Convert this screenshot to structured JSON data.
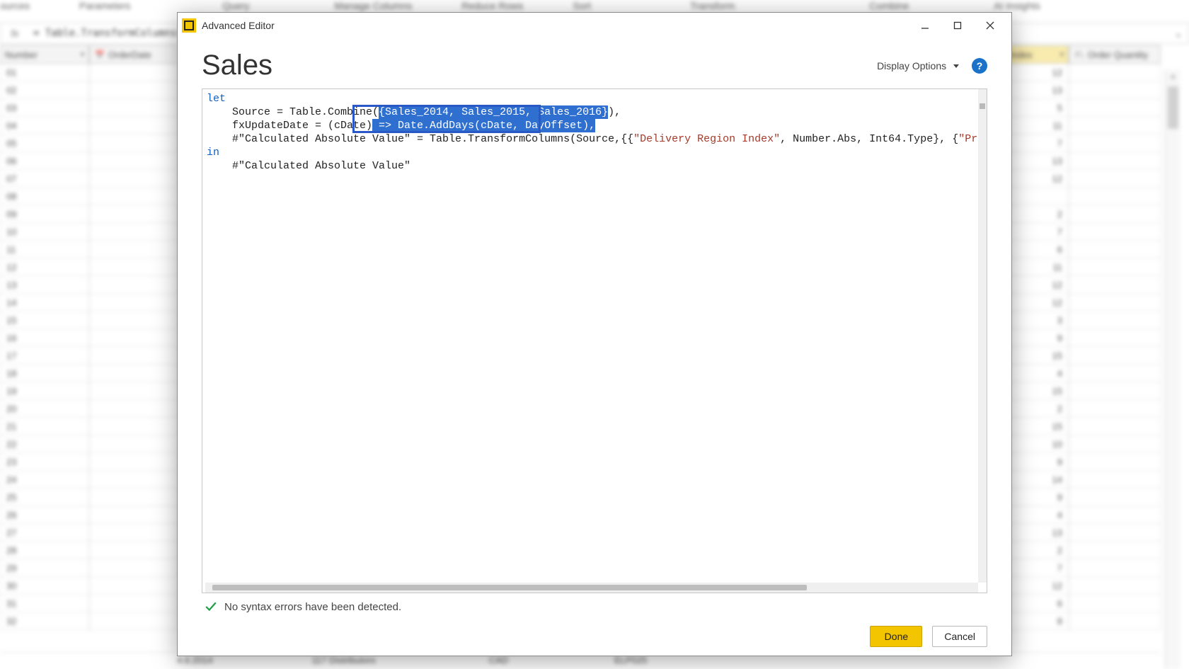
{
  "ribbon": {
    "items": [
      "ources",
      "Parameters",
      "Query",
      "Manage Columns",
      "Reduce Rows",
      "Sort",
      "Transform",
      "Combine",
      "AI Insights"
    ]
  },
  "formula_bar": {
    "fx_label": "fx",
    "text": "= Table.TransformColumns(S",
    "chevron_label": "⌄"
  },
  "grid": {
    "left_headers": {
      "col_a": "Number",
      "col_b": "OrderDate"
    },
    "right_headers": {
      "col_a": "Index",
      "col_b": "Order Quantity"
    },
    "row_labels": [
      "01",
      "02",
      "03",
      "04",
      "05",
      "06",
      "07",
      "08",
      "09",
      "10",
      "11",
      "12",
      "13",
      "14",
      "15",
      "16",
      "17",
      "18",
      "19",
      "20",
      "21",
      "22",
      "23",
      "24",
      "25",
      "26",
      "27",
      "28",
      "29",
      "30",
      "31",
      "32"
    ],
    "right_col_a_values": [
      "12",
      "13",
      "5",
      "11",
      "7",
      "13",
      "12",
      "",
      "2",
      "7",
      "6",
      "11",
      "12",
      "12",
      "3",
      "9",
      "15",
      "4",
      "15",
      "2",
      "15",
      "10",
      "9",
      "14",
      "9",
      "4",
      "13",
      "2",
      "7",
      "12",
      "6",
      "8"
    ],
    "footer": [
      "4.6.2014",
      "117  Distributors",
      "CAD",
      "ELP025"
    ]
  },
  "dialog": {
    "title": "Advanced Editor",
    "query_name": "Sales",
    "display_options_label": "Display Options",
    "help_label": "?",
    "status_text": "No syntax errors have been detected.",
    "done_label": "Done",
    "cancel_label": "Cancel",
    "code": {
      "line1_kw": "let",
      "line2_a": "    Source = Table.Combine(",
      "line2_sel": "{Sales_2014, Sales_2015, Sales_2016}",
      "line2_b": "),",
      "line3_a": "    fxUpdateDate = (cDate)",
      "line3_sel": " => Date.AddDays(cDate, DayOffset),",
      "line4_a": "    #\"Calculated Absolute Value\" = Table.TransformColumns(Source,{{",
      "line4_s1": "\"Delivery Region Index\"",
      "line4_b": ", Number.Abs, Int64.Type}, {",
      "line4_s2": "\"Product Description In",
      "line5_kw": "in",
      "line6": "    #\"Calculated Absolute Value\""
    }
  }
}
